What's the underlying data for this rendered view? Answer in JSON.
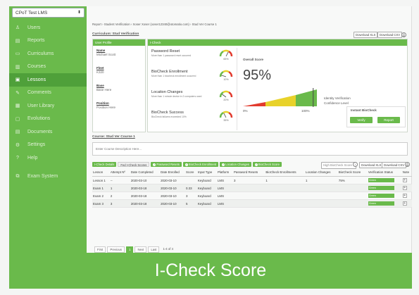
{
  "app_select": "CPoT Test LMS",
  "nav": [
    {
      "icon": "♙",
      "label": "Users",
      "name": "users"
    },
    {
      "icon": "▤",
      "label": "Reports",
      "name": "reports"
    },
    {
      "icon": "▭",
      "label": "Curriculums",
      "name": "curriculums"
    },
    {
      "icon": "▥",
      "label": "Courses",
      "name": "courses"
    },
    {
      "icon": "▣",
      "label": "Lessons",
      "name": "lessons",
      "active": true
    },
    {
      "icon": "✎",
      "label": "Comments",
      "name": "comments"
    },
    {
      "icon": "▦",
      "label": "User Library",
      "name": "user-library"
    },
    {
      "icon": "▢",
      "label": "Evolutions",
      "name": "evolutions"
    },
    {
      "icon": "▤",
      "label": "Documents",
      "name": "documents"
    },
    {
      "icon": "⚙",
      "label": "Settings",
      "name": "settings"
    },
    {
      "icon": "?",
      "label": "Help",
      "name": "help"
    },
    {
      "icon": "⧉",
      "label": "Exam System",
      "name": "exam-system"
    }
  ],
  "breadcrumb": "Report › Student Verification › Xoser Xoser (xoser12340@otomatio.com) › Stud Ver Course 1",
  "curriculum": "Curriculum: Stud Verification",
  "download_xls": "Download XLS",
  "download_csv": "Download CSV",
  "profile": {
    "header": "User Profile",
    "name_k": "Name",
    "name_v": "Michael Scott",
    "fleet_k": "Fleet",
    "fleet_v": "K320",
    "base_k": "Base",
    "base_v": "Base Here",
    "position_k": "Position",
    "position_v": "Position Here"
  },
  "icheck": {
    "header": "I-Check",
    "metrics": [
      {
        "title": "Password Reset",
        "sub": "More than 1 password reset occurred",
        "pct": "65%",
        "value": 65
      },
      {
        "title": "BioCheck Enrollment",
        "sub": "More than 1 biocheck enrollment occurred",
        "pct": "10%",
        "value": 10
      },
      {
        "title": "Location Changes",
        "sub": "More than 1 minute device in 2 computers used",
        "pct": "20%",
        "value": 20
      },
      {
        "title": "BioCheck Success",
        "sub": "BioCheck failures exceeded 10%",
        "pct": "35%",
        "value": 35
      }
    ],
    "overall_title": "Overall Score",
    "overall_value": "95%",
    "overall_num": 95,
    "scale_min": "0%",
    "scale_max": "100%",
    "identity_line1": "Identity Verification",
    "identity_line2": "Confidence Level",
    "instant": "Instant BioCheck",
    "verify": "Verify",
    "report": "Report"
  },
  "course": "Course: Stud Ver Course 1",
  "desc_placeholder": "Enter Course Description Here...",
  "tabs": [
    {
      "label": "I-Check Details",
      "style": "green"
    },
    {
      "label": "Fed I-Check Scores",
      "style": "plain"
    },
    {
      "label": "Password Resets",
      "style": "ok"
    },
    {
      "label": "BioCheck Enrollment",
      "style": "ok"
    },
    {
      "label": "Location Changes",
      "style": "ok"
    },
    {
      "label": "BioCheck Score",
      "style": "ok"
    }
  ],
  "sort_select": "High BioCheck Score",
  "table": {
    "headers": [
      "Lesson",
      "Attempt Nº",
      "Date Completed",
      "Date Enrolled",
      "Score",
      "Input Type",
      "Platform",
      "Password Resets",
      "BioCheck Enrollments",
      "Location Changes",
      "BioCheck Score",
      "Verification Status",
      "Note"
    ],
    "rows": [
      [
        "Lesson 1",
        "--",
        "2020-03-10",
        "2020-03-10",
        "",
        "Keyboard",
        "LMS",
        "3",
        "1",
        "1",
        "75%",
        "Green",
        ""
      ],
      [
        "Exam 1",
        "1",
        "2020-03-18",
        "2020-03-10",
        "0.33",
        "Keyboard",
        "LMS",
        "",
        "",
        "",
        "",
        "Green",
        ""
      ],
      [
        "Exam 2",
        "2",
        "2020-03-18",
        "2020-03-10",
        "3",
        "Keyboard",
        "LMS",
        "",
        "",
        "",
        "",
        "Green",
        ""
      ],
      [
        "Exam 3",
        "3",
        "2020-03-18",
        "2020-03-10",
        "5",
        "Keyboard",
        "LMS",
        "",
        "",
        "",
        "",
        "Green",
        ""
      ]
    ]
  },
  "pager": {
    "first": "First",
    "prev": "Previous",
    "page": "1",
    "next": "Next",
    "last": "Last",
    "info": "1-4 of 4"
  },
  "banner": "I-Check Score",
  "colors": {
    "green": "#6aba4b",
    "red": "#e23b2e",
    "yellow": "#e8d22a"
  }
}
